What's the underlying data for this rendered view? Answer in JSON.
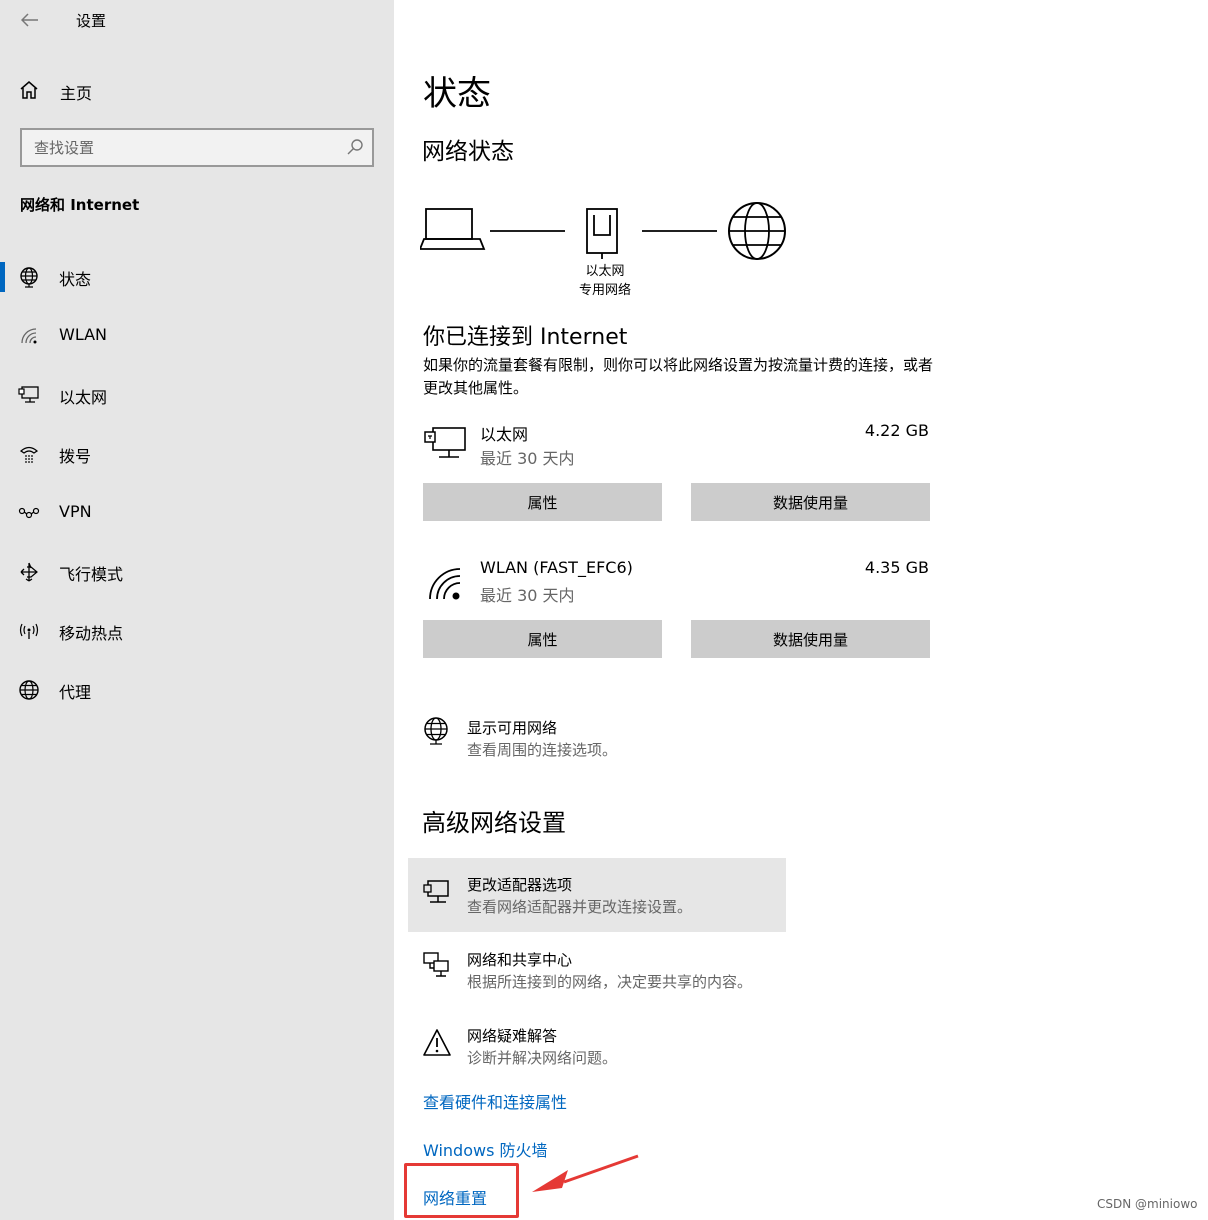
{
  "app": {
    "title": "设置"
  },
  "sidebar": {
    "home_label": "主页",
    "search_placeholder": "查找设置",
    "section_title": "网络和 Internet",
    "items": [
      {
        "label": "状态",
        "icon": "globe-status-icon",
        "active": true
      },
      {
        "label": "WLAN",
        "icon": "wifi-icon"
      },
      {
        "label": "以太网",
        "icon": "ethernet-icon"
      },
      {
        "label": "拨号",
        "icon": "dialup-icon"
      },
      {
        "label": "VPN",
        "icon": "vpn-icon"
      },
      {
        "label": "飞行模式",
        "icon": "airplane-icon"
      },
      {
        "label": "移动热点",
        "icon": "hotspot-icon"
      },
      {
        "label": "代理",
        "icon": "globe-icon"
      }
    ]
  },
  "main": {
    "title": "状态",
    "network_status_heading": "网络状态",
    "diagram": {
      "adapter_label": "以太网",
      "network_label": "专用网络"
    },
    "connected_title": "你已连接到 Internet",
    "connected_desc": "如果你的流量套餐有限制，则你可以将此网络设置为按流量计费的连接，或者更改其他属性。",
    "connections": [
      {
        "name": "以太网",
        "period": "最近 30 天内",
        "usage": "4.22 GB",
        "properties_label": "属性",
        "data_usage_label": "数据使用量"
      },
      {
        "name": "WLAN (FAST_EFC6)",
        "period": "最近 30 天内",
        "usage": "4.35 GB",
        "properties_label": "属性",
        "data_usage_label": "数据使用量"
      }
    ],
    "show_networks": {
      "title": "显示可用网络",
      "desc": "查看周围的连接选项。"
    },
    "advanced_heading": "高级网络设置",
    "advanced": [
      {
        "title": "更改适配器选项",
        "desc": "查看网络适配器并更改连接设置。"
      },
      {
        "title": "网络和共享中心",
        "desc": "根据所连接到的网络，决定要共享的内容。"
      },
      {
        "title": "网络疑难解答",
        "desc": "诊断并解决网络问题。"
      }
    ],
    "links": {
      "hardware": "查看硬件和连接属性",
      "firewall": "Windows 防火墙",
      "reset": "网络重置"
    }
  },
  "watermark": "CSDN @miniowo",
  "colors": {
    "accent": "#0067c0",
    "annotation": "#e53935",
    "sidebar_bg": "#e6e6e6",
    "button_bg": "#cccccc"
  }
}
